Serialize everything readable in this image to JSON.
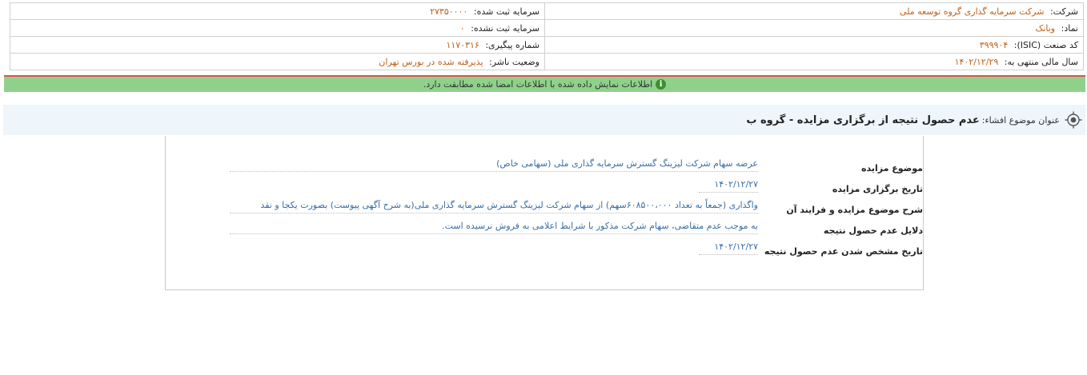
{
  "company_info": {
    "company_label": "شرکت:",
    "company_value": "شرکت سرمایه گذاری گروه توسعه ملی",
    "registered_capital_label": "سرمایه ثبت شده:",
    "registered_capital_value": "۲۷۳۵۰۰۰۰",
    "symbol_label": "نماد:",
    "symbol_value": "وبانک",
    "unregistered_capital_label": "سرمایه ثبت نشده:",
    "unregistered_capital_value": "۰",
    "isic_label": "کد صنعت (ISIC):",
    "isic_value": "۳۹۹۹۰۴",
    "tracking_label": "شماره پیگیری:",
    "tracking_value": "۱۱۷۰۳۱۶",
    "fiscal_label": "سال مالی منتهی به:",
    "fiscal_value": "۱۴۰۲/۱۲/۲۹",
    "status_label": "وضعیت ناشر:",
    "status_value": "پذیرفته شده در بورس تهران"
  },
  "notice": {
    "icon": "info-icon",
    "icon_glyph": "i",
    "text": "اطلاعات نمایش داده شده با اطلاعات امضا شده مطابقت دارد."
  },
  "topic": {
    "icon": "target-icon",
    "label": "عنوان موضوع افشاء:",
    "title": "عدم حصول نتیجه از برگزاری مزایده - گروه ب"
  },
  "details": [
    {
      "label": "موضوع مزایده",
      "value": "عرضه سهام شرکت لیزینگ گسترش سرمایه گذاری ملی (سهامی خاص)"
    },
    {
      "label": "تاریخ برگزاری مزایده",
      "value": "۱۴۰۲/۱۲/۲۷"
    },
    {
      "label": "شرح موضوع مزایده و فرایند آن",
      "value": "واگذاری (جمعاً به تعداد ۶۰۸۵۰۰،۰۰۰سهم) از سهام شرکت لیزینگ گسترش سرمایه گذاری ملی(به شرح آگهی پیوست) بصورت یکجا و نقد"
    },
    {
      "label": "دلایل عدم حصول نتیجه",
      "value": "به موجب عدم متقاضی، سهام شرکت مذکور با شرایط اعلامی به فروش نرسیده است."
    },
    {
      "label": "تاریخ مشخص شدن عدم حصول نتیجه",
      "value": "۱۴۰۲/۱۲/۲۷"
    }
  ]
}
